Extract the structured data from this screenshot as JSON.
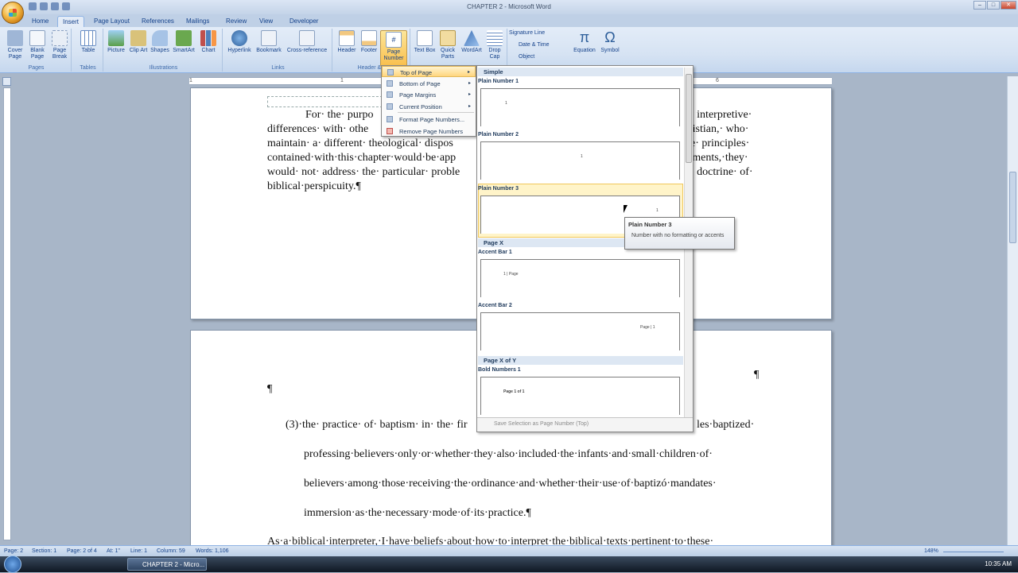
{
  "window": {
    "title": "CHAPTER 2 - Microsoft Word"
  },
  "tabs": [
    "Home",
    "Insert",
    "Page Layout",
    "References",
    "Mailings",
    "Review",
    "View",
    "Developer"
  ],
  "ribbon": {
    "buttons": {
      "cover_page": "Cover Page",
      "blank_page": "Blank Page",
      "page_break": "Page Break",
      "table": "Table",
      "picture": "Picture",
      "clip_art": "Clip Art",
      "shapes": "Shapes",
      "smartart": "SmartArt",
      "chart": "Chart",
      "hyperlink": "Hyperlink",
      "bookmark": "Bookmark",
      "cross_reference": "Cross-reference",
      "header": "Header",
      "footer": "Footer",
      "page_number": "Page Number",
      "text_box": "Text Box",
      "quick_parts": "Quick Parts",
      "wordart": "WordArt",
      "drop_cap": "Drop Cap",
      "signature_line": "Signature Line",
      "date_time": "Date & Time",
      "object": "Object",
      "equation": "Equation",
      "symbol": "Symbol"
    },
    "groups": {
      "pages": "Pages",
      "tables": "Tables",
      "illustrations": "Illustrations",
      "links": "Links",
      "header_footer": "Header & F"
    }
  },
  "menu": {
    "items": [
      {
        "label": "Top of Page",
        "arrow": "▸"
      },
      {
        "label": "Bottom of Page",
        "arrow": "▸"
      },
      {
        "label": "Page Margins",
        "arrow": "▸"
      },
      {
        "label": "Current Position",
        "arrow": "▸"
      },
      {
        "label": "Format Page Numbers..."
      },
      {
        "label": "Remove Page Numbers"
      }
    ]
  },
  "gallery": {
    "sections": [
      "Simple",
      "Page X",
      "Page X of Y"
    ],
    "entries": [
      {
        "name": "Plain Number 1",
        "sample": "1"
      },
      {
        "name": "Plain Number 2",
        "sample": "1"
      },
      {
        "name": "Plain Number 3",
        "sample": "1"
      },
      {
        "name": "Accent Bar 1",
        "sample": "1 | Page"
      },
      {
        "name": "Accent Bar 2",
        "sample": "Page | 1"
      },
      {
        "name": "Bold Numbers 1",
        "sample": "Page 1 of 1"
      }
    ],
    "footer": "Save Selection as Page Number (Top)"
  },
  "tooltip": {
    "title": "Plain Number 3",
    "description": "Number with no formatting or accents"
  },
  "document": {
    "page1_lines": [
      "For· the· purpo",
      "differences· with· othe",
      "maintain· a· different· theological· dispos",
      "contained·with·this·chapter·would·be·app",
      "would· not· address· the· particular· proble",
      "biblical·perspicuity.¶"
    ],
    "page1_right": [
      "· interpretive·",
      "ristian,· who·",
      "e· principles·",
      "ements,·they·",
      "· doctrine· of·"
    ],
    "pilcrow": "¶",
    "page2_lines": [
      "(3)·the· practice· of· baptism· in· the· fir",
      "les·baptized·",
      "professing·believers·only·or·whether·they·also·included·the·infants·and·small·children·of·",
      "believers·among·those·receiving·the·ordinance·and·whether·their·use·of·baptizó·mandates·",
      "immersion·as·the·necessary·mode·of·its·practice.¶",
      "As·a·biblical·interpreter,·I·have·beliefs·about·how·to·interpret·the·biblical·texts·pertinent·to·these·"
    ]
  },
  "ruler": {
    "ticks": [
      "1",
      "1",
      "6"
    ]
  },
  "status": {
    "page": "Page: 2",
    "section": "Section: 1",
    "page_of": "Page: 2 of 4",
    "at": "At: 1\"",
    "line": "Line: 1",
    "column": "Column: 59",
    "words": "Words: 1,106",
    "zoom": "148%"
  },
  "taskbar": {
    "item": "CHAPTER 2 - Micro...",
    "clock": "10:35 AM"
  }
}
